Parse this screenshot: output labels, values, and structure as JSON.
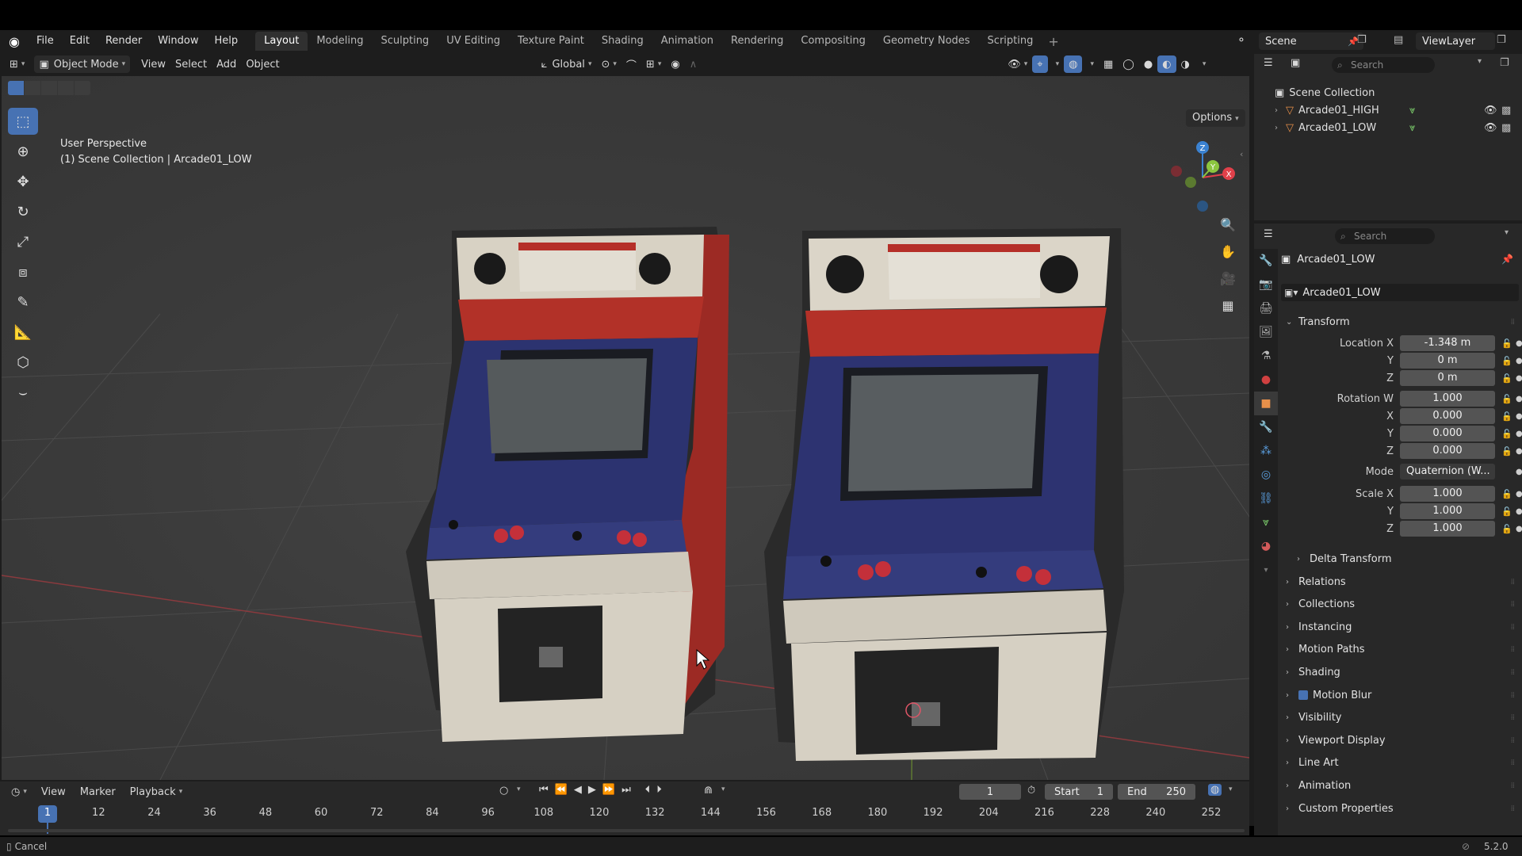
{
  "menu": [
    "File",
    "Edit",
    "Render",
    "Window",
    "Help"
  ],
  "workspaces": [
    "Layout",
    "Modeling",
    "Sculpting",
    "UV Editing",
    "Texture Paint",
    "Shading",
    "Animation",
    "Rendering",
    "Compositing",
    "Geometry Nodes",
    "Scripting"
  ],
  "active_workspace": "Layout",
  "scene_name": "Scene",
  "view_layer": "ViewLayer",
  "viewport": {
    "mode": "Object Mode",
    "menus": [
      "View",
      "Select",
      "Add",
      "Object"
    ],
    "transform_orientation": "Global",
    "options_label": "Options",
    "perspective_label": "User Perspective",
    "collection_label": "(1) Scene Collection | Arcade01_LOW",
    "gizmo": {
      "x": "X",
      "y": "Y",
      "z": "Z"
    }
  },
  "outliner": {
    "search_placeholder": "Search",
    "root": "Scene Collection",
    "items": [
      {
        "name": "Arcade01_HIGH"
      },
      {
        "name": "Arcade01_LOW"
      }
    ]
  },
  "properties": {
    "search_placeholder": "Search",
    "object_name": "Arcade01_LOW",
    "object_name_field": "Arcade01_LOW",
    "transform_label": "Transform",
    "rows": [
      {
        "label": "Location X",
        "value": "-1.348 m"
      },
      {
        "label": "Y",
        "value": "0 m"
      },
      {
        "label": "Z",
        "value": "0 m"
      },
      {
        "label": "Rotation W",
        "value": "1.000"
      },
      {
        "label": "X",
        "value": "0.000"
      },
      {
        "label": "Y",
        "value": "0.000"
      },
      {
        "label": "Z",
        "value": "0.000"
      },
      {
        "label": "Mode",
        "value": "Quaternion (W..."
      },
      {
        "label": "Scale X",
        "value": "1.000"
      },
      {
        "label": "Y",
        "value": "1.000"
      },
      {
        "label": "Z",
        "value": "1.000"
      }
    ],
    "delta_transform": "Delta Transform",
    "panels": [
      "Relations",
      "Collections",
      "Instancing",
      "Motion Paths",
      "Shading",
      "Motion Blur",
      "Visibility",
      "Viewport Display",
      "Line Art",
      "Animation",
      "Custom Properties"
    ]
  },
  "timeline": {
    "menus": [
      "View",
      "Marker",
      "Playback"
    ],
    "current_frame": "1",
    "start_label": "Start",
    "start": "1",
    "end_label": "End",
    "end": "250",
    "ticks": [
      "1",
      "12",
      "24",
      "36",
      "48",
      "60",
      "72",
      "84",
      "96",
      "108",
      "120",
      "132",
      "144",
      "156",
      "168",
      "180",
      "192",
      "204",
      "216",
      "228",
      "240",
      "252"
    ]
  },
  "status": {
    "left": "Cancel",
    "version": "5.2.0"
  },
  "colors": {
    "accent": "#4772b3",
    "axis_x": "#e0404a",
    "axis_y": "#8cc63f",
    "axis_z": "#3b82d1"
  }
}
